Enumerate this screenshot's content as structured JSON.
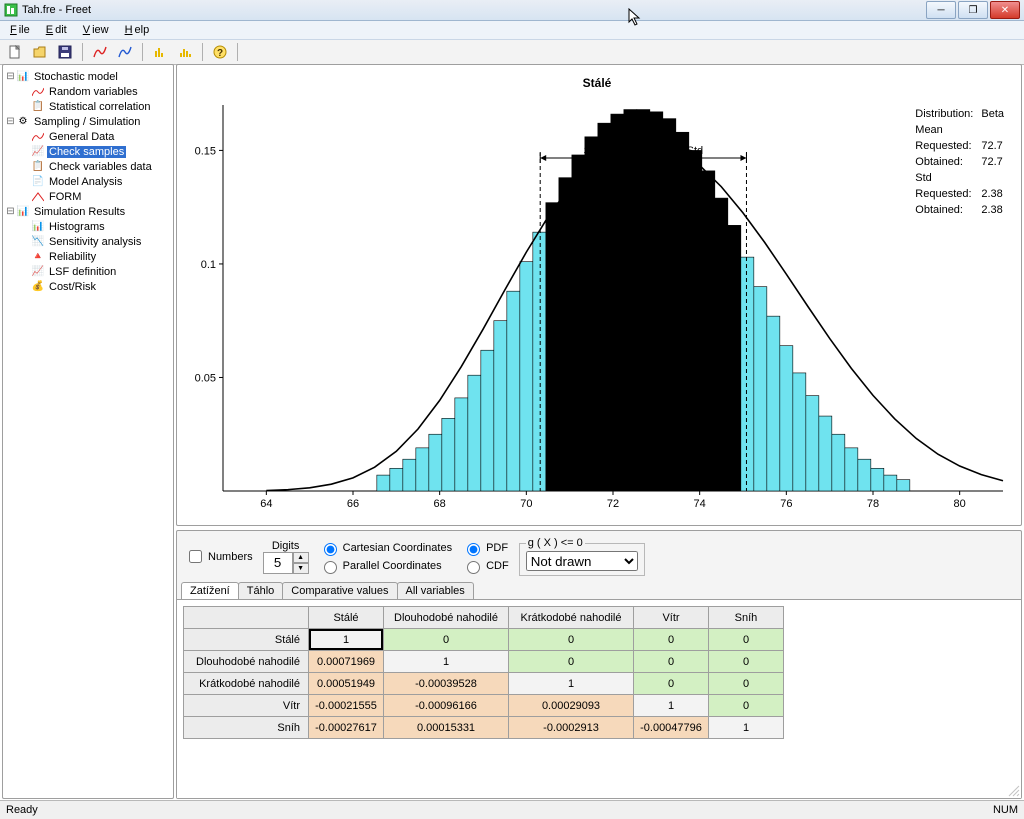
{
  "window": {
    "title": "Tah.fre - Freet"
  },
  "menu": {
    "file": "File",
    "edit": "Edit",
    "view": "View",
    "help": "Help"
  },
  "tree": {
    "root": {
      "label": "Stochastic model",
      "children": [
        {
          "label": "Random variables"
        },
        {
          "label": "Statistical correlation"
        }
      ]
    },
    "sampling": {
      "label": "Sampling / Simulation",
      "children": [
        {
          "label": "General Data"
        },
        {
          "label": "Check samples",
          "selected": true
        },
        {
          "label": "Check variables data"
        },
        {
          "label": "Model Analysis"
        },
        {
          "label": "FORM"
        }
      ]
    },
    "results": {
      "label": "Simulation Results",
      "children": [
        {
          "label": "Histograms"
        },
        {
          "label": "Sensitivity analysis"
        },
        {
          "label": "Reliability"
        },
        {
          "label": "LSF definition"
        },
        {
          "label": "Cost/Risk"
        }
      ]
    }
  },
  "chart_info": {
    "title": "Stálé",
    "distribution_label": "Distribution:",
    "distribution_value": "Beta",
    "mean_label": "Mean",
    "requested_label": "Requested:",
    "obtained_label": "Obtained:",
    "mean_requested": "72.7",
    "mean_obtained": "72.7",
    "std_label": "Std",
    "std_requested": "2.38",
    "std_obtained": "2.38",
    "ann_mean": "Mean",
    "ann_std_l": "Std",
    "ann_std_r": "Std"
  },
  "chart_data": {
    "type": "bar",
    "title": "Stálé",
    "xlabel": "",
    "ylabel": "",
    "xlim": [
      63,
      81
    ],
    "ylim": [
      0,
      0.17
    ],
    "x_ticks": [
      64,
      66,
      68,
      70,
      72,
      74,
      76,
      78,
      80
    ],
    "y_ticks": [
      0.05,
      0.1,
      0.15
    ],
    "mean": 72.7,
    "std": 2.38,
    "annotations": [
      "Mean",
      "Std",
      "Std"
    ],
    "series": [
      {
        "name": "histogram",
        "x": [
          66.7,
          67.0,
          67.3,
          67.6,
          67.9,
          68.2,
          68.5,
          68.8,
          69.1,
          69.4,
          69.7,
          70.0,
          70.3,
          70.6,
          70.9,
          71.2,
          71.5,
          71.8,
          72.1,
          72.4,
          72.7,
          73.0,
          73.3,
          73.6,
          73.9,
          74.2,
          74.5,
          74.8,
          75.1,
          75.4,
          75.7,
          76.0,
          76.3,
          76.6,
          76.9,
          77.2,
          77.5,
          77.8,
          78.1,
          78.4,
          78.7
        ],
        "y": [
          0.007,
          0.01,
          0.014,
          0.019,
          0.025,
          0.032,
          0.041,
          0.051,
          0.062,
          0.075,
          0.088,
          0.101,
          0.114,
          0.127,
          0.138,
          0.148,
          0.156,
          0.162,
          0.166,
          0.168,
          0.168,
          0.167,
          0.164,
          0.158,
          0.15,
          0.141,
          0.129,
          0.117,
          0.103,
          0.09,
          0.077,
          0.064,
          0.052,
          0.042,
          0.033,
          0.025,
          0.019,
          0.014,
          0.01,
          0.007,
          0.005
        ]
      },
      {
        "name": "pdf",
        "x": [
          64,
          64.5,
          65,
          65.5,
          66,
          66.5,
          67,
          67.5,
          68,
          68.5,
          69,
          69.5,
          70,
          70.5,
          71,
          71.5,
          72,
          72.5,
          73,
          73.5,
          74,
          74.5,
          75,
          75.5,
          76,
          76.5,
          77,
          77.5,
          78,
          78.5,
          79,
          79.5,
          80,
          80.5,
          81
        ],
        "y": [
          0.0002,
          0.0006,
          0.0014,
          0.003,
          0.0058,
          0.0105,
          0.0175,
          0.0273,
          0.0399,
          0.0548,
          0.0712,
          0.0884,
          0.1052,
          0.1207,
          0.1339,
          0.1442,
          0.1512,
          0.1544,
          0.154,
          0.1502,
          0.1434,
          0.134,
          0.1225,
          0.1095,
          0.0955,
          0.0812,
          0.0672,
          0.054,
          0.0421,
          0.0318,
          0.0231,
          0.0162,
          0.011,
          0.0072,
          0.0045
        ]
      }
    ]
  },
  "options": {
    "numbers": "Numbers",
    "digits": "Digits",
    "digits_value": "5",
    "coord_cart": "Cartesian Coordinates",
    "coord_par": "Parallel Coordinates",
    "pdf": "PDF",
    "cdf": "CDF",
    "gx_label": "g ( X ) <= 0",
    "gx_value": "Not drawn"
  },
  "tabs": {
    "t0": "Zatížení",
    "t1": "Táhlo",
    "t2": "Comparative values",
    "t3": "All variables"
  },
  "corr": {
    "headers": [
      "Stálé",
      "Dlouhodobé nahodilé",
      "Krátkodobé nahodilé",
      "Vítr",
      "Sníh"
    ],
    "rows": [
      {
        "h": "Stálé",
        "c": [
          "1",
          "0",
          "0",
          "0",
          "0"
        ],
        "diag": 0
      },
      {
        "h": "Dlouhodobé nahodilé",
        "c": [
          "0.00071969",
          "1",
          "0",
          "0",
          "0"
        ],
        "diag": 1
      },
      {
        "h": "Krátkodobé nahodilé",
        "c": [
          "0.00051949",
          "-0.00039528",
          "1",
          "0",
          "0"
        ],
        "diag": 2
      },
      {
        "h": "Vítr",
        "c": [
          "-0.00021555",
          "-0.00096166",
          "0.00029093",
          "1",
          "0"
        ],
        "diag": 3
      },
      {
        "h": "Sníh",
        "c": [
          "-0.00027617",
          "0.00015331",
          "-0.0002913",
          "-0.00047796",
          "1"
        ],
        "diag": 4
      }
    ]
  },
  "status": {
    "ready": "Ready",
    "num": "NUM"
  }
}
